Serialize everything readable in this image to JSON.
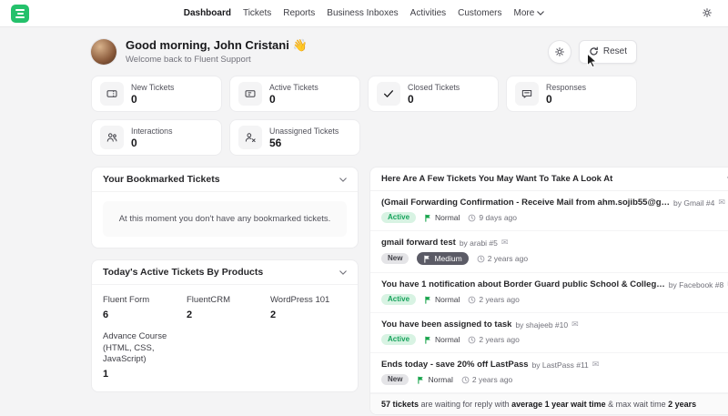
{
  "navbar": {
    "items": [
      "Dashboard",
      "Tickets",
      "Reports",
      "Business Inboxes",
      "Activities",
      "Customers"
    ],
    "more": "More"
  },
  "header": {
    "greeting": "Good morning, John Cristani 👋",
    "subtitle": "Welcome back to Fluent Support",
    "reset": "Reset"
  },
  "stats": [
    {
      "label": "New Tickets",
      "value": "0",
      "icon": "ticket-icon"
    },
    {
      "label": "Active Tickets",
      "value": "0",
      "icon": "ticket-icon"
    },
    {
      "label": "Closed Tickets",
      "value": "0",
      "icon": "check-icon"
    },
    {
      "label": "Responses",
      "value": "0",
      "icon": "chat-icon"
    },
    {
      "label": "Interactions",
      "value": "0",
      "icon": "interactions-icon"
    },
    {
      "label": "Unassigned Tickets",
      "value": "56",
      "icon": "user-x-icon"
    }
  ],
  "bookmarked": {
    "title": "Your Bookmarked Tickets",
    "empty": "At this moment you don't have any bookmarked tickets."
  },
  "products": {
    "title": "Today's Active Tickets By Products",
    "items": [
      {
        "name": "Fluent Form",
        "count": "6"
      },
      {
        "name": "FluentCRM",
        "count": "2"
      },
      {
        "name": "WordPress 101",
        "count": "2"
      },
      {
        "name": "Advance Course (HTML, CSS, JavaScript)",
        "count": "1"
      }
    ]
  },
  "suggested": {
    "title": "Here Are A Few Tickets You May Want To Take A Look At",
    "tickets": [
      {
        "title": "(Gmail Forwarding Confirmation - Receive Mail from ahm.sojib55@g…",
        "by": "by Gmail #4",
        "status": "Active",
        "priority": "Normal",
        "time": "9 days ago"
      },
      {
        "title": "gmail forward test",
        "by": "by arabi #5",
        "status": "New",
        "priority": "Medium",
        "time": "2 years ago"
      },
      {
        "title": "You have 1 notification about Border Guard public School & Colleg…",
        "by": "by Facebook #8",
        "status": "Active",
        "priority": "Normal",
        "time": "2 years ago"
      },
      {
        "title": "You have been assigned to task",
        "by": "by shajeeb #10",
        "status": "Active",
        "priority": "Normal",
        "time": "2 years ago"
      },
      {
        "title": "Ends today - save 20% off LastPass",
        "by": "by LastPass #11",
        "status": "New",
        "priority": "Normal",
        "time": "2 years ago"
      }
    ],
    "footer": {
      "bold1": "57 tickets",
      "text1": " are waiting for reply with ",
      "bold2": "average 1 year wait time",
      "text2": " & max wait time ",
      "bold3": "2 years"
    }
  },
  "colors": {
    "brand_green": "#24c16b",
    "badge_active_bg": "#d8f3e3",
    "badge_active_text": "#17a35c",
    "background": "#f4f4f5"
  }
}
